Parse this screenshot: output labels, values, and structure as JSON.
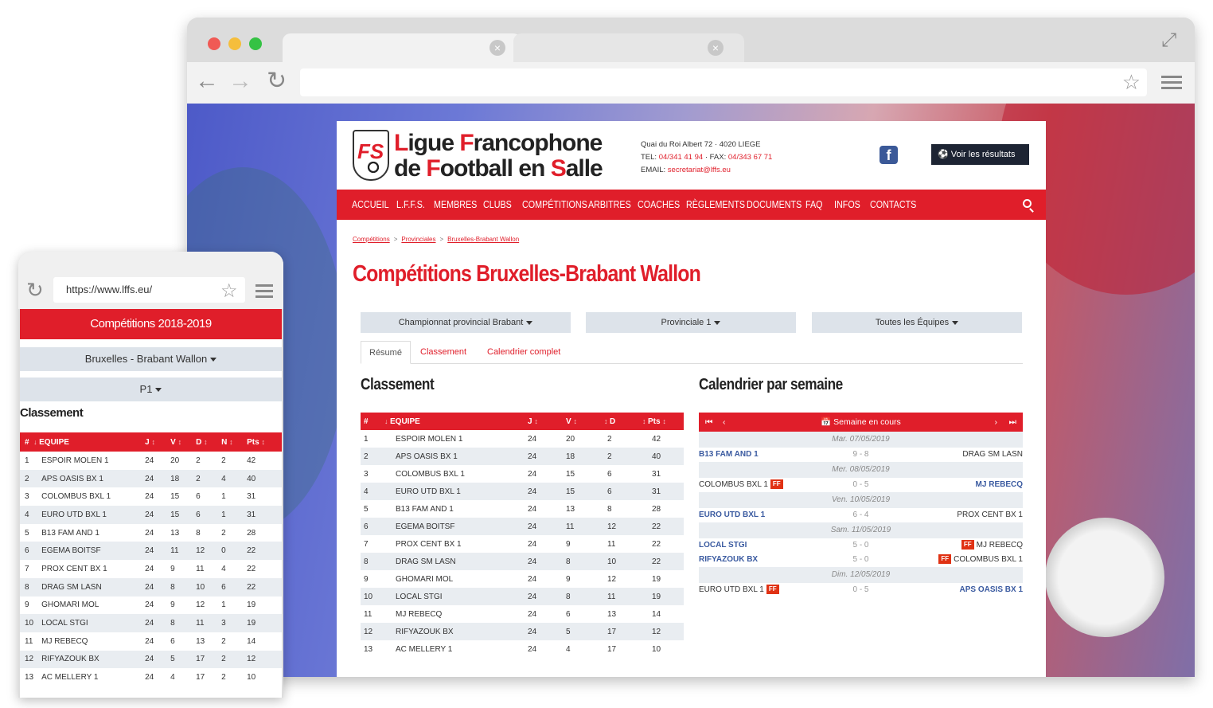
{
  "colors": {
    "brand_red": "#e01e2a",
    "dark": "#1d2433",
    "row_alt": "#e9edf1",
    "ff_badge": "#e03214"
  },
  "site": {
    "logo_line1_parts": [
      "L",
      "igue ",
      "F",
      "rancophone"
    ],
    "logo_line2_parts": [
      "de ",
      "F",
      "ootball en ",
      "S",
      "alle"
    ],
    "logo_badge_text": "FS",
    "address": "Quai du Roi Albert 72 · 4020 LIEGE",
    "tel_label": "TEL: ",
    "tel": "04/341 41 94",
    "fax_label": " · FAX: ",
    "fax": "04/343 67 71",
    "email_label": "EMAIL: ",
    "email": "secretariat@lffs.eu",
    "facebook": "f",
    "results_button": "Voir les résultats",
    "nav": [
      "ACCUEIL",
      "L.F.F.S.",
      "MEMBRES",
      "CLUBS",
      "COMPÉTITIONS",
      "ARBITRES",
      "COACHES",
      "RÈGLEMENTS",
      "DOCUMENTS",
      "FAQ",
      "INFOS",
      "CONTACTS"
    ],
    "breadcrumb": [
      "Compétitions",
      "Provinciales",
      "Bruxelles-Brabant Wallon"
    ],
    "page_title": "Compétitions Bruxelles-Brabant Wallon",
    "selects": [
      "Championnat provincial Brabant",
      "Provinciale 1",
      "Toutes les Équipes"
    ],
    "tabs": [
      "Résumé",
      "Classement",
      "Calendrier complet"
    ],
    "classement_title": "Classement",
    "calendar_title": "Calendrier par semaine",
    "table_headers": [
      "#",
      "EQUIPE",
      "J",
      "V",
      "D",
      "Pts"
    ],
    "calendar_header": "Semaine en cours",
    "calendar": [
      {
        "day": "Mar. 07/05/2019",
        "matches": [
          {
            "home": "B13 FAM AND 1",
            "score": "9 - 8",
            "away": "DRAG SM LASN",
            "winner": "home",
            "ff": ""
          }
        ]
      },
      {
        "day": "Mer. 08/05/2019",
        "matches": [
          {
            "home": "COLOMBUS BXL 1",
            "score": "0 - 5",
            "away": "MJ REBECQ",
            "winner": "away",
            "ff": "home"
          }
        ]
      },
      {
        "day": "Ven. 10/05/2019",
        "matches": [
          {
            "home": "EURO UTD BXL 1",
            "score": "6 - 4",
            "away": "PROX CENT BX 1",
            "winner": "home",
            "ff": ""
          }
        ]
      },
      {
        "day": "Sam. 11/05/2019",
        "matches": [
          {
            "home": "LOCAL STGI",
            "score": "5 - 0",
            "away": "MJ REBECQ",
            "winner": "home",
            "ff": "away"
          },
          {
            "home": "RIFYAZOUK BX",
            "score": "5 - 0",
            "away": "COLOMBUS BXL 1",
            "winner": "home",
            "ff": "away"
          }
        ]
      },
      {
        "day": "Dim. 12/05/2019",
        "matches": [
          {
            "home": "EURO UTD BXL 1",
            "score": "0 - 5",
            "away": "APS OASIS BX 1",
            "winner": "away",
            "ff": "home"
          }
        ]
      }
    ],
    "ff_label": "FF"
  },
  "standings": [
    {
      "rank": "1",
      "team": "ESPOIR MOLEN 1",
      "j": "24",
      "v": "20",
      "d": "2",
      "n": "2",
      "pts": "42"
    },
    {
      "rank": "2",
      "team": "APS OASIS BX 1",
      "j": "24",
      "v": "18",
      "d": "2",
      "n": "4",
      "pts": "40"
    },
    {
      "rank": "3",
      "team": "COLOMBUS BXL 1",
      "j": "24",
      "v": "15",
      "d": "6",
      "n": "1",
      "pts": "31"
    },
    {
      "rank": "4",
      "team": "EURO UTD BXL 1",
      "j": "24",
      "v": "15",
      "d": "6",
      "n": "1",
      "pts": "31"
    },
    {
      "rank": "5",
      "team": "B13 FAM AND 1",
      "j": "24",
      "v": "13",
      "d": "8",
      "n": "2",
      "pts": "28"
    },
    {
      "rank": "6",
      "team": "EGEMA BOITSF",
      "j": "24",
      "v": "11",
      "d": "12",
      "n": "0",
      "pts": "22"
    },
    {
      "rank": "7",
      "team": "PROX CENT BX 1",
      "j": "24",
      "v": "9",
      "d": "11",
      "n": "4",
      "pts": "22"
    },
    {
      "rank": "8",
      "team": "DRAG SM LASN",
      "j": "24",
      "v": "8",
      "d": "10",
      "n": "6",
      "pts": "22"
    },
    {
      "rank": "9",
      "team": "GHOMARI MOL",
      "j": "24",
      "v": "9",
      "d": "12",
      "n": "1",
      "pts": "19"
    },
    {
      "rank": "10",
      "team": "LOCAL STGI",
      "j": "24",
      "v": "8",
      "d": "11",
      "n": "3",
      "pts": "19"
    },
    {
      "rank": "11",
      "team": "MJ REBECQ",
      "j": "24",
      "v": "6",
      "d": "13",
      "n": "2",
      "pts": "14"
    },
    {
      "rank": "12",
      "team": "RIFYAZOUK BX",
      "j": "24",
      "v": "5",
      "d": "17",
      "n": "2",
      "pts": "12"
    },
    {
      "rank": "13",
      "team": "AC MELLERY 1",
      "j": "24",
      "v": "4",
      "d": "17",
      "n": "2",
      "pts": "10"
    }
  ],
  "mobile": {
    "url": "https://www.lffs.eu/",
    "banner": "Compétitions 2018-2019",
    "select_region": "Bruxelles - Brabant Wallon",
    "select_division": "P1",
    "classement_title": "Classement",
    "table_headers": [
      "#",
      "EQUIPE",
      "J",
      "V",
      "D",
      "N",
      "Pts"
    ]
  },
  "icons": [
    "back-arrow-icon",
    "forward-arrow-icon",
    "reload-icon",
    "star-icon",
    "menu-icon",
    "expand-icon",
    "tab-close-icon",
    "facebook-icon",
    "soccer-ball-icon",
    "search-icon",
    "calendar-icon",
    "sort-icon"
  ]
}
